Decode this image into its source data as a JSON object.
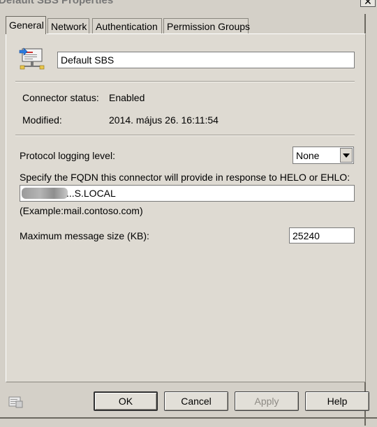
{
  "window": {
    "title": "Default SBS Properties",
    "close_glyph": "✕"
  },
  "tabs": [
    {
      "label": "General",
      "active": true
    },
    {
      "label": "Network",
      "active": false
    },
    {
      "label": "Authentication",
      "active": false
    },
    {
      "label": "Permission Groups",
      "active": false
    }
  ],
  "general": {
    "icon": "connector-icon",
    "name_value": "Default SBS",
    "connector_status_label": "Connector status:",
    "connector_status_value": "Enabled",
    "modified_label": "Modified:",
    "modified_value": "2014. május 26. 16:11:54",
    "logging_label": "Protocol logging level:",
    "logging_value": "None",
    "fqdn_label": "Specify the FQDN this connector will provide in response to HELO or EHLO:",
    "fqdn_value_visible": "...S.LOCAL",
    "fqdn_redacted": true,
    "fqdn_example": "(Example:mail.contoso.com)",
    "max_size_label": "Maximum message size (KB):",
    "max_size_value": "25240"
  },
  "buttons": {
    "ok": "OK",
    "cancel": "Cancel",
    "apply": "Apply",
    "help": "Help"
  }
}
